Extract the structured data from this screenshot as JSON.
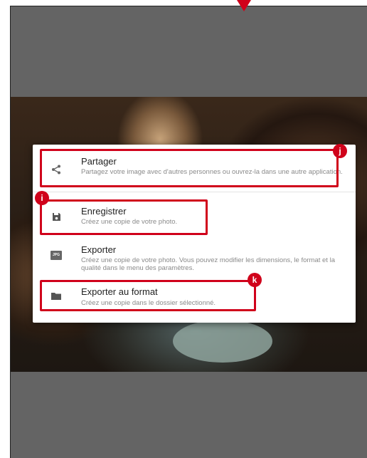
{
  "menu": {
    "items": [
      {
        "title": "Partager",
        "description": "Partagez votre image avec d'autres personnes ou ouvrez-la dans une autre application.",
        "icon": "share-icon"
      },
      {
        "title": "Enregistrer",
        "description": "Créez une copie de votre photo.",
        "icon": "save-icon"
      },
      {
        "title": "Exporter",
        "description": "Créez une copie de votre photo. Vous pouvez modifier les dimensions, le format et la qualité dans le menu des paramètres.",
        "icon": "jpg-file-icon",
        "icon_text": "JPG"
      },
      {
        "title": "Exporter au format",
        "description": "Créez une copie dans le dossier sélectionné.",
        "icon": "folder-icon"
      }
    ]
  },
  "callouts": {
    "share": "j",
    "save": "i",
    "export_format": "k"
  },
  "colors": {
    "highlight": "#d0021b",
    "backdrop": "#646464"
  }
}
